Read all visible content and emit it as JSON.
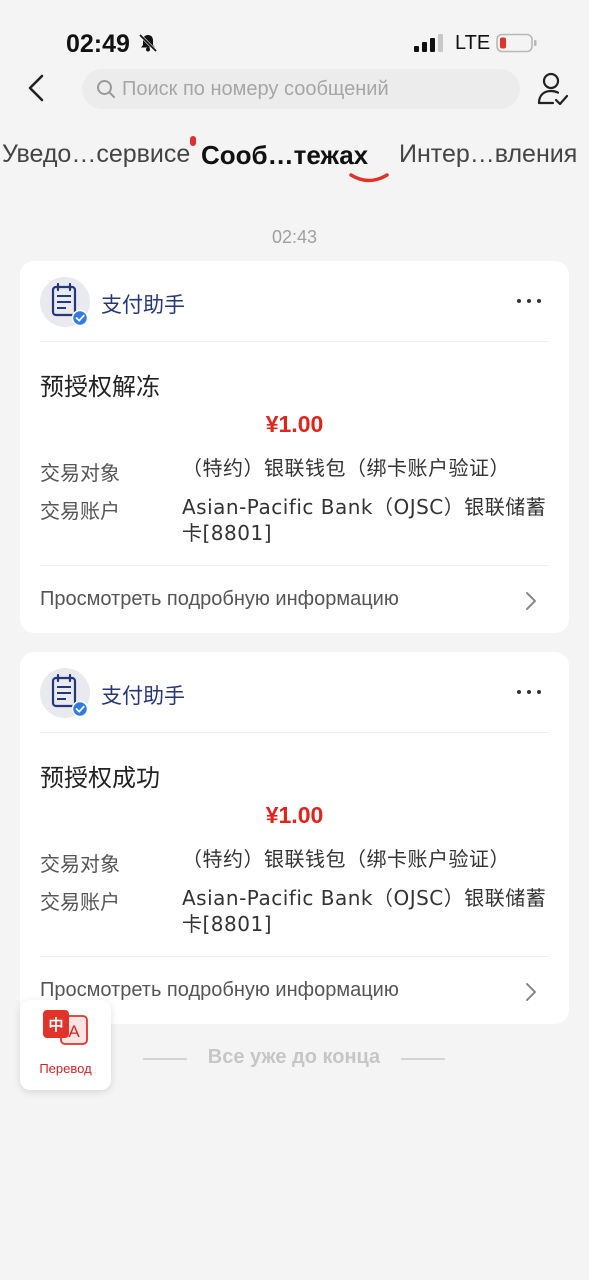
{
  "status_bar": {
    "time": "02:49",
    "network": "LTE"
  },
  "search": {
    "placeholder": "Поиск по номеру сообщений"
  },
  "tabs": [
    {
      "label": "Уведо…сервисе",
      "active": false
    },
    {
      "label": "Сооб…тежах",
      "active": true
    },
    {
      "label": "Интер…вления",
      "active": false
    }
  ],
  "timestamp": "02:43",
  "messages": [
    {
      "sender": "支付助手",
      "title": "预授权解冻",
      "amount": "¥1.00",
      "fields": [
        {
          "label": "交易对象",
          "value": "（特约）银联钱包（绑卡账户验证）"
        },
        {
          "label": "交易账户",
          "value": "Asian-Pacific Bank（OJSC）银联储蓄卡[8801]"
        }
      ],
      "details_link": "Просмотреть подробную информацию"
    },
    {
      "sender": "支付助手",
      "title": "预授权成功",
      "amount": "¥1.00",
      "fields": [
        {
          "label": "交易对象",
          "value": "（特约）银联钱包（绑卡账户验证）"
        },
        {
          "label": "交易账户",
          "value": "Asian-Pacific Bank（OJSC）银联储蓄卡[8801]"
        }
      ],
      "details_link": "Просмотреть подробную информацию"
    }
  ],
  "end_of_list": "Все уже до конца",
  "translate": {
    "label": "Перевод",
    "icon_glyphs": [
      "中",
      "A"
    ]
  },
  "colors": {
    "accent_red": "#e1251b",
    "sender_blue": "#26367a",
    "badge_blue": "#2f7ae5"
  }
}
